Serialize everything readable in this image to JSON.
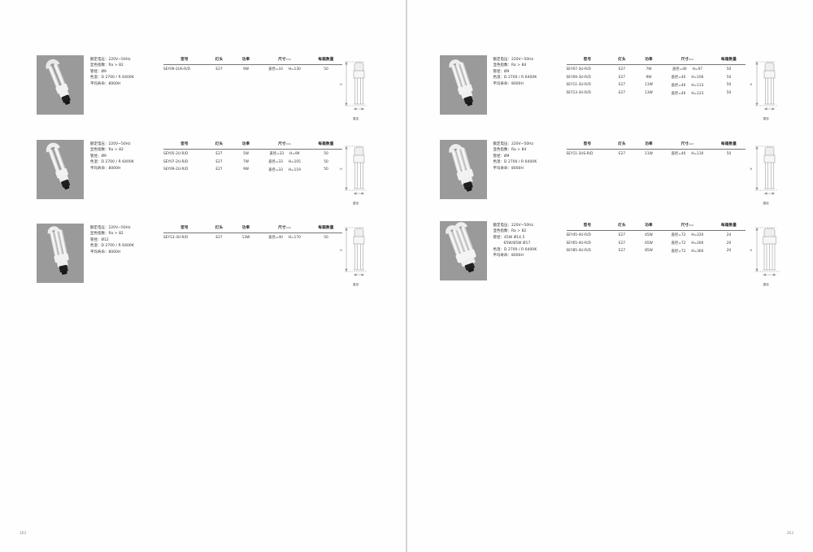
{
  "document": {
    "page_left_number": "262",
    "page_right_number": "263"
  },
  "table_headers": {
    "model": "型号",
    "base": "灯头",
    "power": "功率",
    "size": "尺寸",
    "size_unit": "mm",
    "qty": "每箱数量"
  },
  "diagram": {
    "height_label": "H",
    "diameter_label": "直径"
  },
  "blocks": [
    {
      "id": "left-1",
      "photo_name": "cfl-2u-bulb-photo",
      "specs": [
        "额定电压：220V~50Hz",
        "显色指数：Ra > 82",
        "管径：Ø9",
        "色温：D 2700 / R 6400K",
        "平均寿命：8000H"
      ],
      "rows": [
        {
          "model": "SEY09-2US-R/D",
          "base": "E27",
          "power": "9W",
          "diameter": "直径=33",
          "height": "H=130",
          "qty": "50"
        }
      ]
    },
    {
      "id": "left-2",
      "photo_name": "cfl-2u-bulb-photo",
      "specs": [
        "额定电压：220V~50Hz",
        "显色指数：Ra > 82",
        "管径：Ø9",
        "色温：D 2700 / R 6400K",
        "平均寿命：8000H"
      ],
      "rows": [
        {
          "model": "SEY05-2U-R/D",
          "base": "E27",
          "power": "5W",
          "diameter": "直径=33",
          "height": "H=99",
          "qty": "50"
        },
        {
          "model": "SEY07-2U-R/D",
          "base": "E27",
          "power": "7W",
          "diameter": "直径=33",
          "height": "H=105",
          "qty": "50"
        },
        {
          "model": "SEY09-2U-R/D",
          "base": "E27",
          "power": "9W",
          "diameter": "直径=33",
          "height": "H=119",
          "qty": "50"
        }
      ]
    },
    {
      "id": "left-3",
      "photo_name": "cfl-3u-bulb-photo",
      "specs": [
        "额定电压：220V~50Hz",
        "显色指数：Ra > 82",
        "管径：Ø12",
        "色温：D 2700 / R 6400K",
        "平均寿命：8000H"
      ],
      "rows": [
        {
          "model": "SEY13-3U-R/D",
          "base": "E27",
          "power": "13W",
          "diameter": "直径=40",
          "height": "H=170",
          "qty": "50"
        }
      ]
    },
    {
      "id": "right-1",
      "photo_name": "cfl-3u-bulb-photo",
      "specs": [
        "额定电压：220V~50Hz",
        "显色指数：Ra > 84",
        "管径：Ø9",
        "色温：D 2700 / R 6400K",
        "平均寿命：8000H"
      ],
      "rows": [
        {
          "model": "SEY07-3U-R/D",
          "base": "E27",
          "power": "7W",
          "diameter": "直径=40",
          "height": "H=97",
          "qty": "50"
        },
        {
          "model": "SEY09-3U-R/D",
          "base": "E27",
          "power": "9W",
          "diameter": "直径=40",
          "height": "H=106",
          "qty": "50"
        },
        {
          "model": "SEY11-3U-R/D",
          "base": "E27",
          "power": "11W",
          "diameter": "直径=40",
          "height": "H=113",
          "qty": "50"
        },
        {
          "model": "SEY13-3U-R/D",
          "base": "E27",
          "power": "13W",
          "diameter": "直径=40",
          "height": "H=123",
          "qty": "50"
        }
      ]
    },
    {
      "id": "right-2",
      "photo_name": "cfl-3us-bulb-photo",
      "specs": [
        "额定电压：220V~50Hz",
        "显色指数：Ra > 84",
        "管径：Ø9",
        "色温：D 2700 / R 6400K",
        "平均寿命：8000H"
      ],
      "rows": [
        {
          "model": "SEY11-3US-R/D",
          "base": "E27",
          "power": "11W",
          "diameter": "直径=40",
          "height": "H=130",
          "qty": "50"
        }
      ]
    },
    {
      "id": "right-3",
      "photo_name": "cfl-4u-bulb-photo",
      "specs": [
        "额定电压：220V~50Hz",
        "显色指数：Ra > 82",
        "管径：45W  Ø14.5",
        "65W/85W  Ø17",
        "色温：D 2700 / R 6400K",
        "平均寿命：8000H"
      ],
      "spec_indent_index": 3,
      "rows": [
        {
          "model": "SEY45-4U-R/D",
          "base": "E27",
          "power": "45W",
          "diameter": "直径=72",
          "height": "H=220",
          "qty": "24"
        },
        {
          "model": "SEY65-4U-R/D",
          "base": "E27",
          "power": "65W",
          "diameter": "直径=72",
          "height": "H=260",
          "qty": "20"
        },
        {
          "model": "SEY85-4U-R/D",
          "base": "E27",
          "power": "85W",
          "diameter": "直径=72",
          "height": "H=360",
          "qty": "20"
        }
      ]
    }
  ],
  "colors": {
    "photo_bg": "#9a9a9a",
    "rule": "#777777",
    "text": "#2b2b2b"
  }
}
